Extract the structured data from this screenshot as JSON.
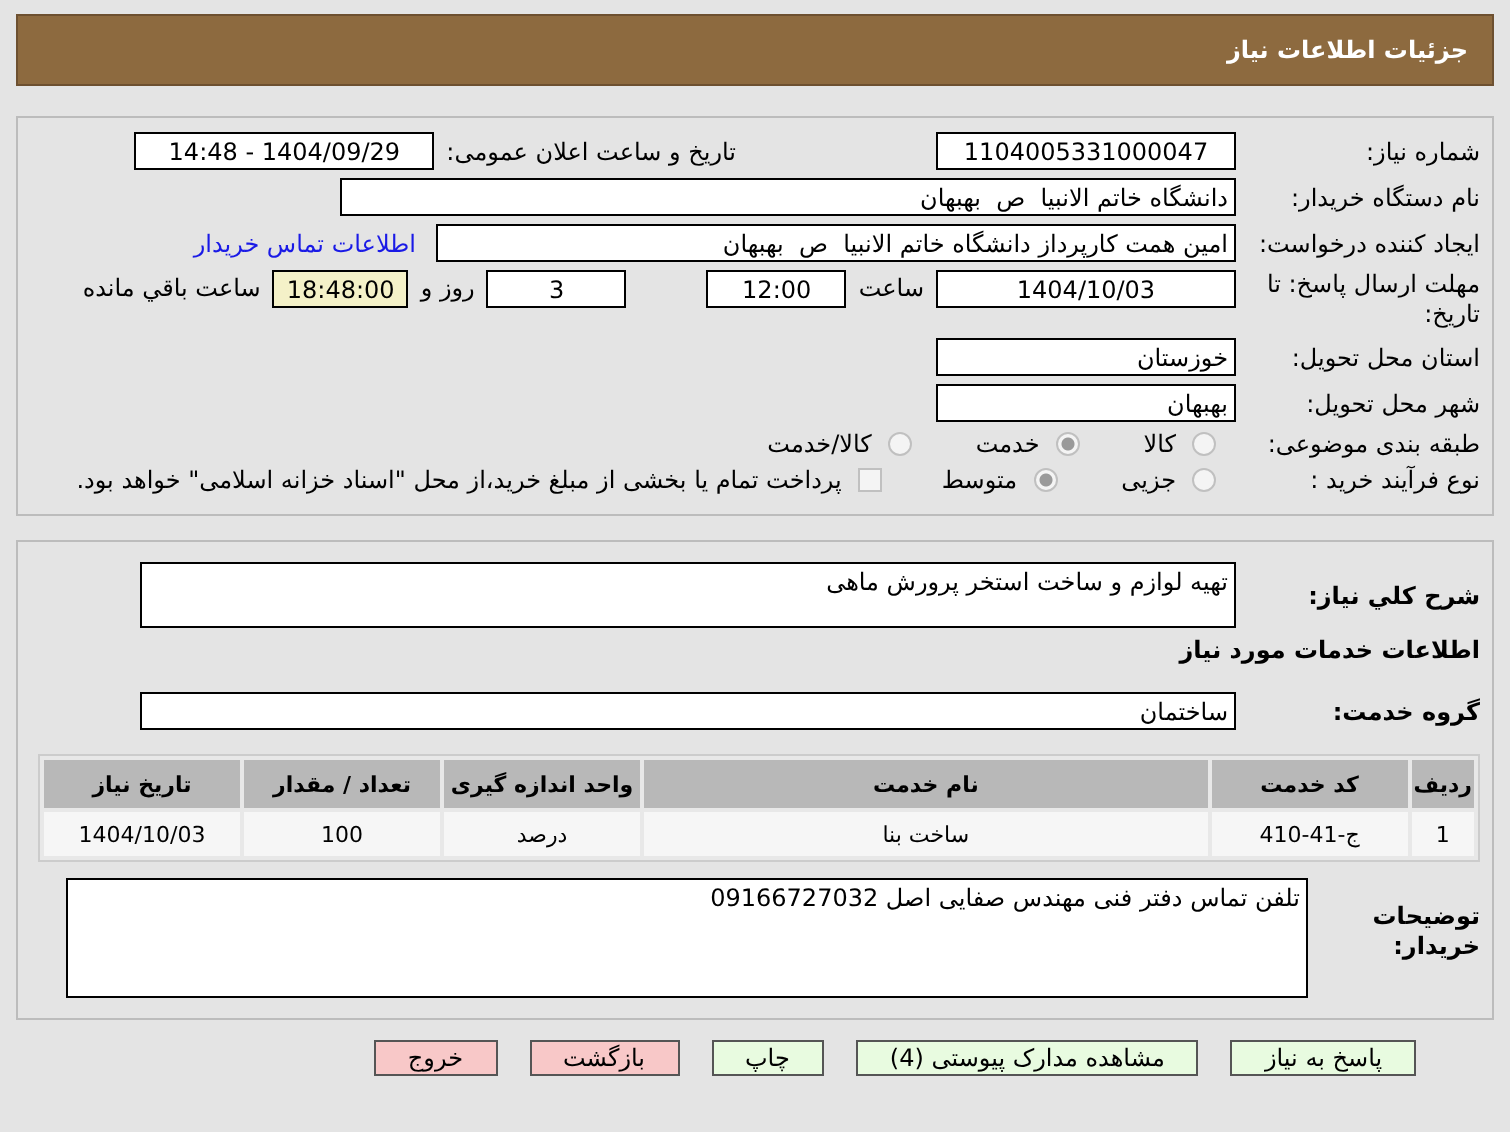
{
  "header": {
    "title": "جزئیات اطلاعات نیاز"
  },
  "need_number": {
    "label": "شماره نیاز:",
    "value": "1104005331000047"
  },
  "announce": {
    "label": "تاریخ و ساعت اعلان عمومی:",
    "value": "1404/09/29 - 14:48"
  },
  "buyer": {
    "label": "نام دستگاه خریدار:",
    "value": "دانشگاه خاتم الانبیا  ص  بهبهان"
  },
  "requester": {
    "label": "ایجاد کننده درخواست:",
    "value": "امین همت کارپرداز دانشگاه خاتم الانبیا  ص  بهبهان",
    "link": "اطلاعات تماس خریدار"
  },
  "deadline": {
    "label": "مهلت ارسال پاسخ: تا تاریخ:",
    "date": "1404/10/03",
    "time_label": "ساعت",
    "time": "12:00",
    "days": "3",
    "days_label": "روز و",
    "remaining": "18:48:00",
    "remaining_label": "ساعت باقي مانده"
  },
  "province": {
    "label": "استان محل تحویل:",
    "value": "خوزستان"
  },
  "city": {
    "label": "شهر محل تحویل:",
    "value": "بهبهان"
  },
  "category": {
    "label": "طبقه بندی موضوعی:",
    "options": [
      {
        "label": "کالا",
        "selected": false
      },
      {
        "label": "خدمت",
        "selected": true
      },
      {
        "label": "کالا/خدمت",
        "selected": false
      }
    ]
  },
  "process": {
    "label": "نوع فرآیند خرید :",
    "options": [
      {
        "label": "جزیی",
        "selected": false
      },
      {
        "label": "متوسط",
        "selected": true
      }
    ],
    "payment": {
      "checked": false,
      "text": "پرداخت تمام یا بخشی از مبلغ خرید،از محل \"اسناد خزانه اسلامی\" خواهد بود."
    }
  },
  "description": {
    "label": "شرح کلي نیاز:",
    "value": "تهیه لوازم و ساخت استخر پرورش ماهی"
  },
  "services_title": "اطلاعات خدمات مورد نیاز",
  "service_group": {
    "label": "گروه خدمت:",
    "value": "ساختمان"
  },
  "table": {
    "columns": [
      "ردیف",
      "کد خدمت",
      "نام خدمت",
      "واحد اندازه گیری",
      "تعداد / مقدار",
      "تاریخ نیاز"
    ],
    "rows": [
      [
        "1",
        "ج-41-410",
        "ساخت بنا",
        "درصد",
        "100",
        "1404/10/03"
      ]
    ]
  },
  "buyer_notes": {
    "label": "توضیحات خریدار:",
    "value": "تلفن تماس دفتر فنی مهندس صفایی اصل 09166727032"
  },
  "buttons": [
    {
      "label": "پاسخ به نیاز",
      "kind": "primary"
    },
    {
      "label": "مشاهده مدارک پیوستی (4)",
      "kind": "primary"
    },
    {
      "label": "چاپ",
      "kind": "primary"
    },
    {
      "label": "بازگشت",
      "kind": "danger"
    },
    {
      "label": "خروج",
      "kind": "danger"
    }
  ]
}
